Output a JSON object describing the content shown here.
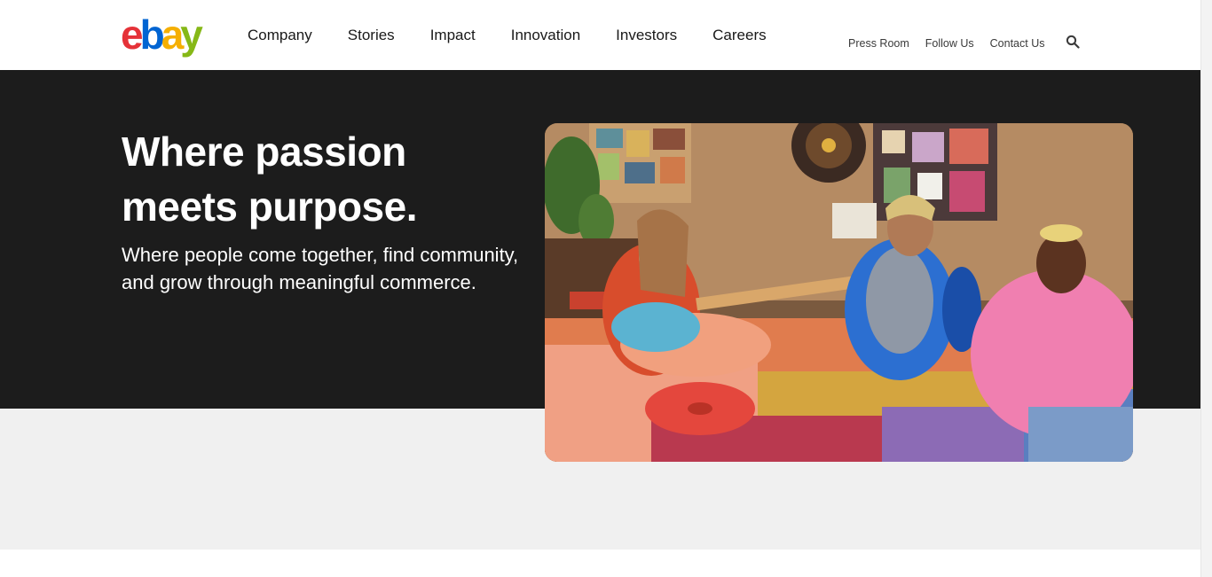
{
  "brand": {
    "logo_letters": [
      "e",
      "b",
      "a",
      "y"
    ],
    "logo_colors": [
      "#e53238",
      "#0064d2",
      "#f5af02",
      "#86b817"
    ]
  },
  "main_nav": {
    "items": [
      {
        "label": "Company"
      },
      {
        "label": "Stories"
      },
      {
        "label": "Impact"
      },
      {
        "label": "Innovation"
      },
      {
        "label": "Investors"
      },
      {
        "label": "Careers"
      }
    ]
  },
  "util_nav": {
    "items": [
      {
        "label": "Press Room"
      },
      {
        "label": "Follow Us"
      },
      {
        "label": "Contact Us"
      }
    ],
    "search_icon": "search-icon"
  },
  "hero": {
    "headline": "Where passion meets purpose.",
    "subline": "Where people come together, find community, and grow through meaningful commerce.",
    "photo_icon": "hero-photo"
  },
  "colors": {
    "hero_background": "#1c1c1c",
    "lower_background": "#f0f0f0"
  }
}
